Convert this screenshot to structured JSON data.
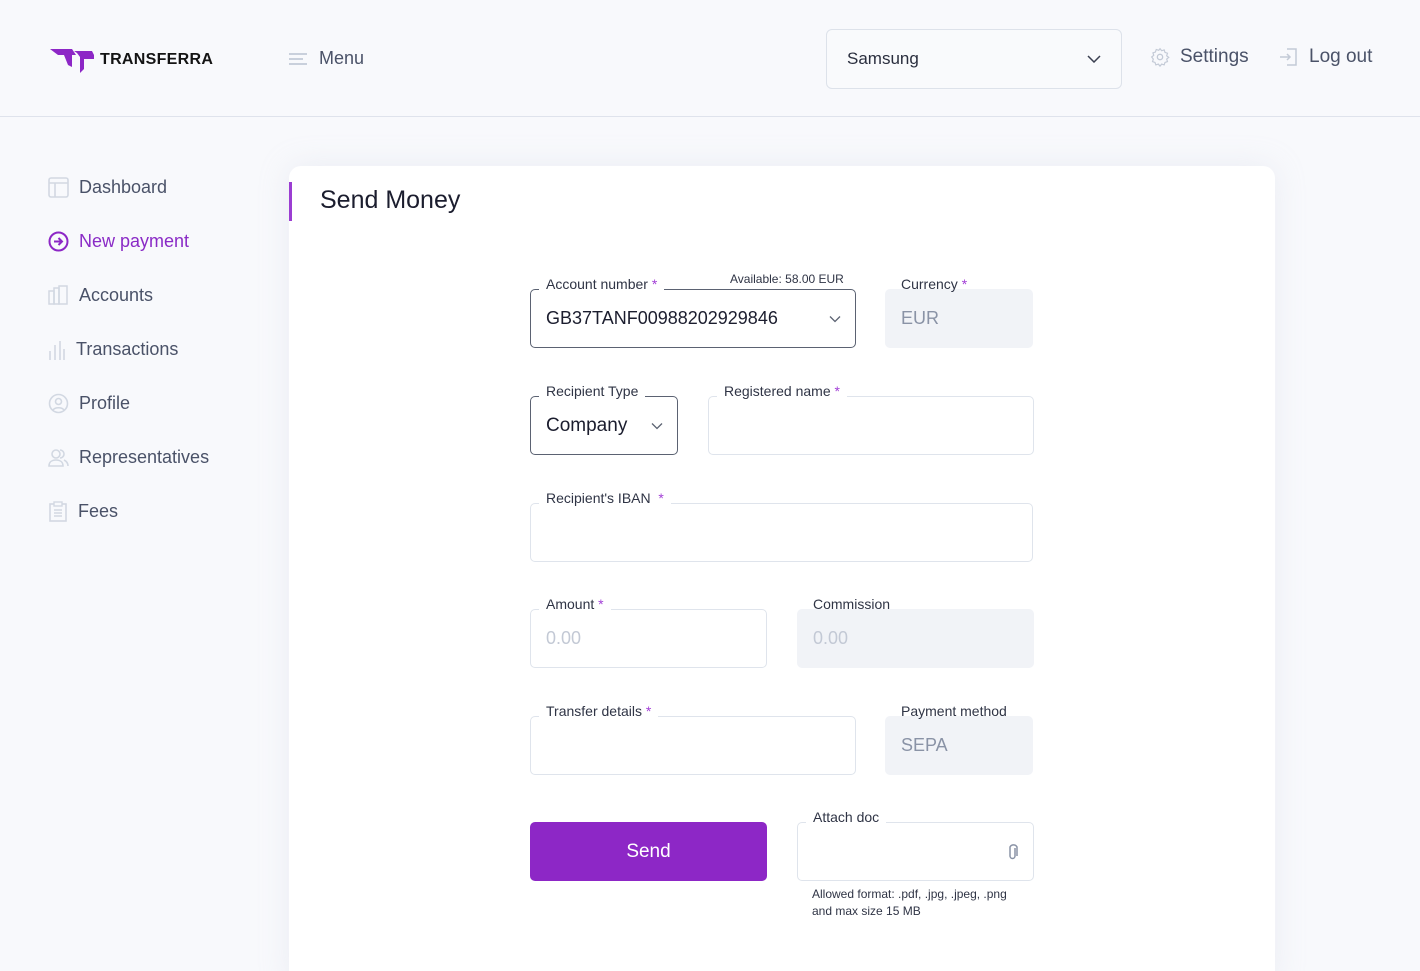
{
  "header": {
    "brand": "TRANSFERRA",
    "menu_label": "Menu",
    "company_select": "Samsung",
    "settings_label": "Settings",
    "logout_label": "Log out"
  },
  "sidebar": {
    "items": [
      {
        "label": "Dashboard",
        "icon": "layout-icon",
        "active": false
      },
      {
        "label": "New payment",
        "icon": "arrow-circle-icon",
        "active": true
      },
      {
        "label": "Accounts",
        "icon": "accounts-icon",
        "active": false
      },
      {
        "label": "Transactions",
        "icon": "bar-chart-icon",
        "active": false
      },
      {
        "label": "Profile",
        "icon": "user-circle-icon",
        "active": false
      },
      {
        "label": "Representatives",
        "icon": "users-icon",
        "active": false
      },
      {
        "label": "Fees",
        "icon": "clipboard-icon",
        "active": false
      }
    ]
  },
  "form": {
    "title": "Send Money",
    "available": "Available: 58.00 EUR",
    "account_number": {
      "label": "Account number",
      "required": "*",
      "value": "GB37TANF00988202929846"
    },
    "currency": {
      "label": "Currency",
      "required": "*",
      "value": "EUR"
    },
    "recipient_type": {
      "label": "Recipient Type",
      "value": "Company"
    },
    "registered_name": {
      "label": "Registered name",
      "required": "*",
      "value": ""
    },
    "iban": {
      "label": "Recipient's IBAN",
      "required": "*",
      "value": ""
    },
    "amount": {
      "label": "Amount",
      "required": "*",
      "placeholder": "0.00"
    },
    "commission": {
      "label": "Commission",
      "placeholder": "0.00"
    },
    "transfer_details": {
      "label": "Transfer details",
      "required": "*",
      "value": ""
    },
    "payment_method": {
      "label": "Payment method",
      "value": "SEPA"
    },
    "attach": {
      "label": "Attach doc",
      "hint_line1": "Allowed format:  .pdf, .jpg, .jpeg,  .png",
      "hint_line2": "and max size 15 MB"
    },
    "send_label": "Send"
  },
  "colors": {
    "accent": "#8d27c6",
    "text": "#1b1d2e",
    "muted": "#4a5268"
  }
}
